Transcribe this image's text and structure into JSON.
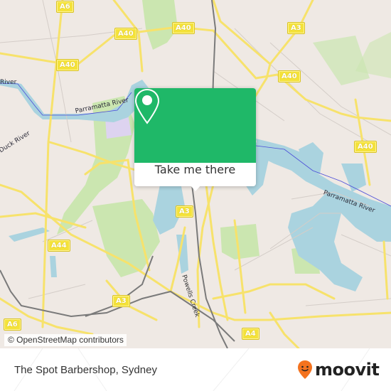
{
  "map": {
    "road_shields": [
      {
        "label": "A6",
        "pos": "top-left"
      },
      {
        "label": "A40",
        "pos": "top-center-left"
      },
      {
        "label": "A40",
        "pos": "top-center"
      },
      {
        "label": "A40",
        "pos": "top-right-left"
      },
      {
        "label": "A3",
        "pos": "top-right"
      },
      {
        "label": "A40",
        "pos": "right-upper"
      },
      {
        "label": "A40",
        "pos": "right"
      },
      {
        "label": "A3",
        "pos": "center"
      },
      {
        "label": "A44",
        "pos": "left-lower"
      },
      {
        "label": "A3",
        "pos": "center-lower"
      },
      {
        "label": "A6",
        "pos": "bottom-left"
      },
      {
        "label": "A4",
        "pos": "bottom-center"
      }
    ],
    "labels": {
      "parramatta_river_west": "Parramatta River",
      "parramatta_river_east": "Parramatta River",
      "river_left": "River",
      "duck_river": "Duck River",
      "powells_creek": "Powells Creek"
    },
    "colors": {
      "land": "#efe9e4",
      "water": "#aad3df",
      "park": "#c8e6a8",
      "road": "#f7e26b",
      "rail": "#777777"
    },
    "attribution": "© OpenStreetMap contributors"
  },
  "popup": {
    "pin_icon": "map-pin-icon",
    "button_label": "Take me there",
    "accent_color": "#1fb868"
  },
  "footer": {
    "title": "The Spot Barbershop, Sydney",
    "brand": "moovit",
    "brand_color": "#f4731f"
  }
}
